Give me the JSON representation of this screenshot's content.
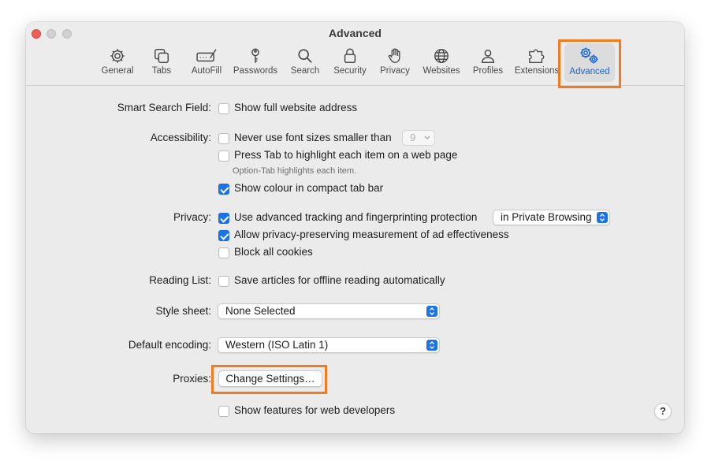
{
  "window": {
    "title": "Advanced"
  },
  "toolbar": {
    "tabs": [
      {
        "label": "General",
        "icon": "gear-icon"
      },
      {
        "label": "Tabs",
        "icon": "tabs-icon"
      },
      {
        "label": "AutoFill",
        "icon": "autofill-icon"
      },
      {
        "label": "Passwords",
        "icon": "key-icon"
      },
      {
        "label": "Search",
        "icon": "search-icon"
      },
      {
        "label": "Security",
        "icon": "lock-icon"
      },
      {
        "label": "Privacy",
        "icon": "hand-icon"
      },
      {
        "label": "Websites",
        "icon": "globe-icon"
      },
      {
        "label": "Profiles",
        "icon": "person-icon"
      },
      {
        "label": "Extensions",
        "icon": "puzzle-icon"
      },
      {
        "label": "Advanced",
        "icon": "gears-icon",
        "selected": true
      }
    ]
  },
  "settings": {
    "smart_search": {
      "label": "Smart Search Field:",
      "show_full_address": {
        "label": "Show full website address",
        "checked": false
      }
    },
    "accessibility": {
      "label": "Accessibility:",
      "min_font": {
        "label": "Never use font sizes smaller than",
        "checked": false,
        "value": "9"
      },
      "press_tab": {
        "label": "Press Tab to highlight each item on a web page",
        "checked": false
      },
      "hint": "Option-Tab highlights each item.",
      "compact_color": {
        "label": "Show colour in compact tab bar",
        "checked": true
      }
    },
    "privacy": {
      "label": "Privacy:",
      "tracking": {
        "label": "Use advanced tracking and fingerprinting protection",
        "checked": true,
        "mode": "in Private Browsing"
      },
      "ad_measurement": {
        "label": "Allow privacy-preserving measurement of ad effectiveness",
        "checked": true
      },
      "block_cookies": {
        "label": "Block all cookies",
        "checked": false
      }
    },
    "reading_list": {
      "label": "Reading List:",
      "offline": {
        "label": "Save articles for offline reading automatically",
        "checked": false
      }
    },
    "style_sheet": {
      "label": "Style sheet:",
      "value": "None Selected"
    },
    "encoding": {
      "label": "Default encoding:",
      "value": "Western (ISO Latin 1)"
    },
    "proxies": {
      "label": "Proxies:",
      "button": "Change Settings…"
    },
    "developer": {
      "label": "Show features for web developers",
      "checked": false
    }
  },
  "help": {
    "label": "?"
  },
  "colors": {
    "accent": "#1a73e8",
    "highlight": "#f47a1f",
    "close": "#ee5f58"
  }
}
